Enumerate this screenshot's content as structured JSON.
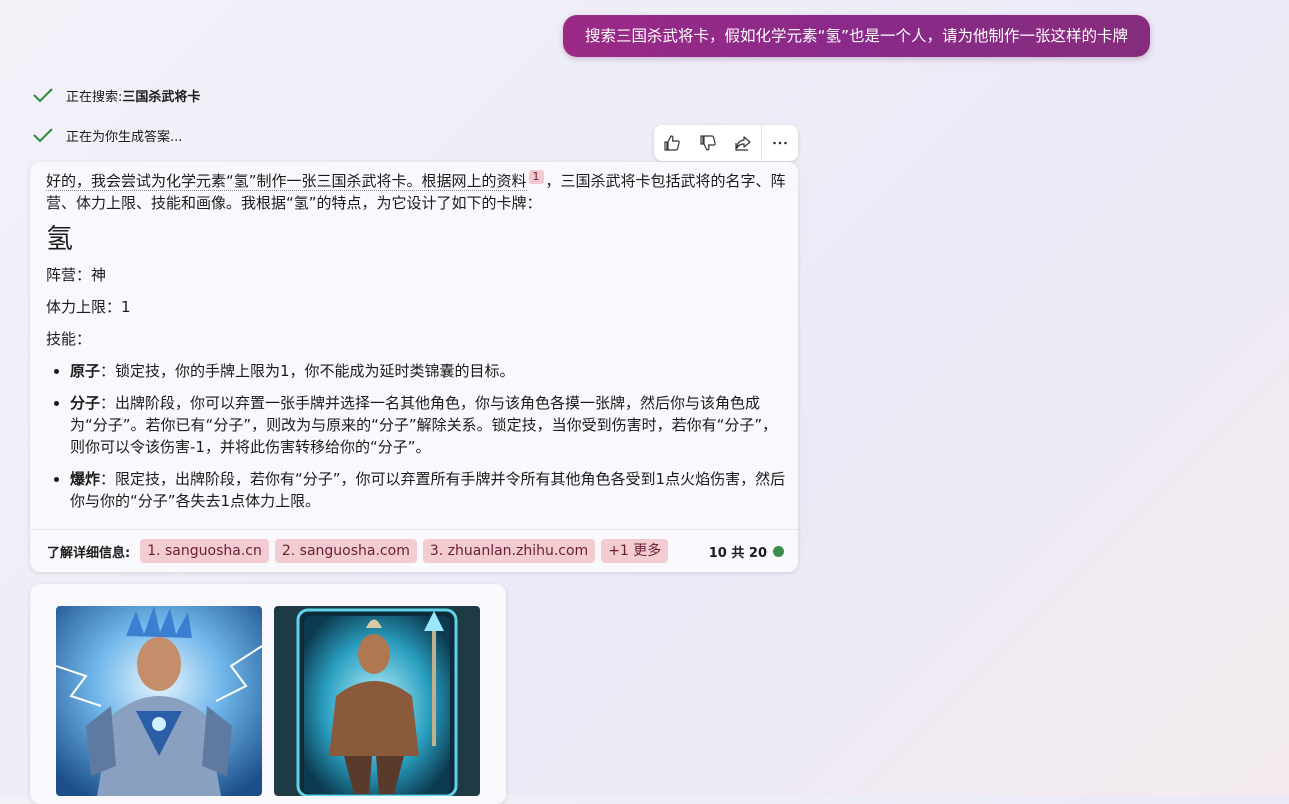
{
  "user_message": "搜索三国杀武将卡，假如化学元素“氢”也是一个人，请为他制作一张这样的卡牌",
  "status": [
    {
      "prefix": "正在搜索: ",
      "term": "三国杀武将卡"
    },
    {
      "prefix": "正在为你生成答案...",
      "term": ""
    }
  ],
  "answer": {
    "intro_part1": "好的，我会尝试为化学元素“氢”制作一张三国杀武将卡。根据网上的资料",
    "intro_cite": "1",
    "intro_part2": "，三国杀武将卡包括武将的名字、阵营、体力上限、技能和画像。我根据“氢”的特点，为它设计了如下的卡牌：",
    "card_name": "氢",
    "faction": "阵营：神",
    "hp": "体力上限：1",
    "skills_label": "技能：",
    "skills": [
      {
        "name": "原子",
        "desc": "：锁定技，你的手牌上限为1，你不能成为延时类锦囊的目标。"
      },
      {
        "name": "分子",
        "desc": "：出牌阶段，你可以弃置一张手牌并选择一名其他角色，你与该角色各摸一张牌，然后你与该角色成为“分子”。若你已有“分子”，则改为与原来的“分子”解除关系。锁定技，当你受到伤害时，若你有“分子”，则你可以令该伤害-1，并将此伤害转移给你的“分子”。"
      },
      {
        "name": "爆炸",
        "desc": "：限定技，出牌阶段，若你有“分子”，你可以弃置所有手牌并令所有其他角色各受到1点火焰伤害，然后你与你的“分子”各失去1点体力上限。"
      }
    ]
  },
  "learn_more": {
    "label": "了解详细信息:",
    "sources": [
      "1. sanguosha.cn",
      "2. sanguosha.com",
      "3. zhuanlan.zhihu.com",
      "+1 更多"
    ],
    "counter": "10 共 20"
  },
  "icons": {
    "thumbs_up": "thumbs-up-icon",
    "thumbs_down": "thumbs-down-icon",
    "share": "share-icon",
    "more": "more-icon",
    "check": "check-icon"
  },
  "colors": {
    "user_bubble": "#8a2a8a",
    "chip_bg": "#f3ccd2",
    "check_green": "#2f8a3c",
    "status_dot": "#3a8e4a"
  }
}
